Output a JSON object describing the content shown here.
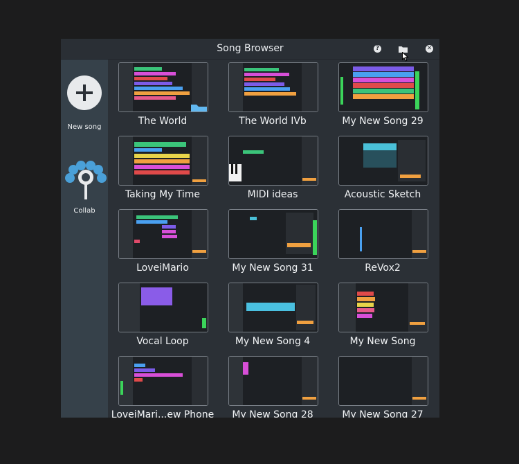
{
  "window": {
    "title": "Song Browser"
  },
  "sidebar": {
    "new_song_label": "New song",
    "collab_label": "Collab"
  },
  "songs": [
    {
      "name": "The World"
    },
    {
      "name": "The World IVb"
    },
    {
      "name": "My New Song 29"
    },
    {
      "name": "Taking My Time"
    },
    {
      "name": "MIDI ideas"
    },
    {
      "name": "Acoustic Sketch"
    },
    {
      "name": "LoveiMario"
    },
    {
      "name": "My New Song 31"
    },
    {
      "name": "ReVox2"
    },
    {
      "name": "Vocal Loop"
    },
    {
      "name": "My New Song 4"
    },
    {
      "name": "My New Song"
    },
    {
      "name": "LoveiMari...ew Phone"
    },
    {
      "name": "My New Song 28"
    },
    {
      "name": "My New Song 27"
    }
  ]
}
